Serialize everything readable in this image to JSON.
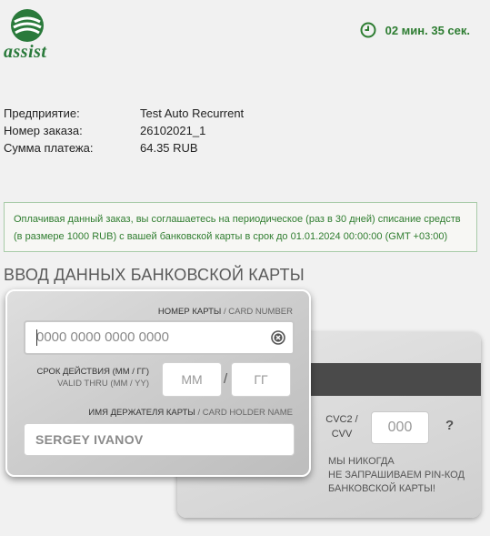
{
  "brand": {
    "logo_text": "assist",
    "color": "#2a7a3b"
  },
  "timer": {
    "text": "02 мин. 35 сек.",
    "icon": "clock-icon"
  },
  "order": {
    "rows": [
      {
        "label": "Предприятие:",
        "value": "Test Auto Recurrent"
      },
      {
        "label": "Номер заказа:",
        "value": "26102021_1"
      },
      {
        "label": "Сумма платежа:",
        "value": "64.35 RUB"
      }
    ]
  },
  "notice": {
    "text": "Оплачивая данный заказ, вы соглашаетесь на периодическое (раз в 30 дней) списание средств (в размере 1000 RUB) с вашей банковской карты в срок до 01.01.2024 00:00:00 (GMT +03:00)"
  },
  "section": {
    "title": "ВВОД ДАННЫХ БАНКОВСКОЙ КАРТЫ"
  },
  "card_front": {
    "number_label_ru": "НОМЕР КАРТЫ",
    "number_label_en": " / CARD NUMBER",
    "number_placeholder": "0000 0000 0000 0000",
    "expiry_label_ru": "СРОК ДЕЙСТВИЯ (ММ / ГГ)",
    "expiry_label_en": "VALID THRU (MM / YY)",
    "month_placeholder": "ММ",
    "year_placeholder": "ГГ",
    "slash": "/",
    "holder_label_ru": "ИМЯ ДЕРЖАТЕЛЯ КАРТЫ",
    "holder_label_en": " / CARD HOLDER NAME",
    "holder_placeholder": "SERGEY IVANOV"
  },
  "card_back": {
    "cvc_label_line1": "CVC2 /",
    "cvc_label_line2": "CVV",
    "cvc_placeholder": "000",
    "help": "?",
    "pin_note_line1": "МЫ НИКОГДА",
    "pin_note_line2": "НЕ ЗАПРАШИВАЕМ PIN-КОД",
    "pin_note_line3": "БАНКОВСКОЙ КАРТЫ!"
  }
}
